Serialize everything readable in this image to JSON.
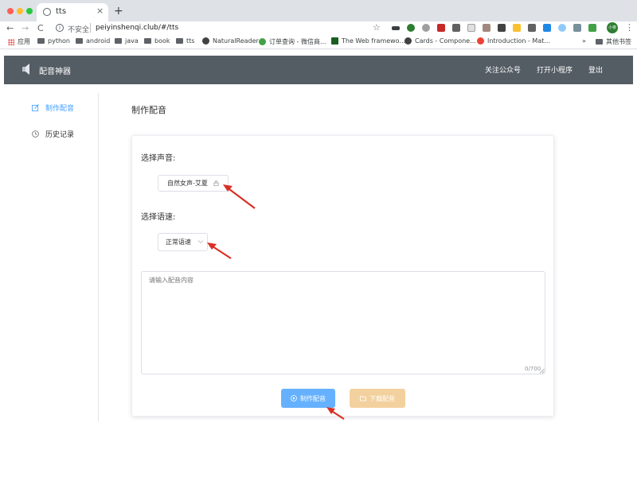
{
  "browser": {
    "tab_title": "tts",
    "tab_close": "×",
    "new_tab": "+",
    "nav_back": "←",
    "nav_forward": "→",
    "reload": "C",
    "security_label": "不安全",
    "url": "peiyinshenqi.club/#/tts",
    "star": "☆",
    "menu": "⋮",
    "avatar_text": "小夜",
    "bookmarks": [
      {
        "label": "应用",
        "icon": "apps-icon"
      },
      {
        "label": "python",
        "icon": "folder-icon"
      },
      {
        "label": "android",
        "icon": "folder-icon"
      },
      {
        "label": "java",
        "icon": "folder-icon"
      },
      {
        "label": "book",
        "icon": "folder-icon"
      },
      {
        "label": "tts",
        "icon": "folder-icon"
      },
      {
        "label": "NaturalReader",
        "icon": "globe-icon"
      },
      {
        "label": "订单查询 - 微信商...",
        "icon": "wechat-icon"
      },
      {
        "label": "The Web framewo...",
        "icon": "django-icon"
      },
      {
        "label": "Cards - Compone...",
        "icon": "globe-icon"
      },
      {
        "label": "Introduction - Mat...",
        "icon": "google-icon"
      },
      {
        "label": "»",
        "icon": "none"
      },
      {
        "label": "其他书签",
        "icon": "folder-icon"
      }
    ]
  },
  "header": {
    "title": "配音神器",
    "links": [
      "关注公众号",
      "打开小程序",
      "登出"
    ]
  },
  "sidebar": {
    "items": [
      {
        "label": "制作配音",
        "active": true
      },
      {
        "label": "历史记录",
        "active": false
      }
    ]
  },
  "main": {
    "page_title": "制作配音",
    "voice_label": "选择声音:",
    "voice_value": "自然女声-艾夏",
    "speed_label": "选择语速:",
    "speed_value": "正常语速",
    "textarea_placeholder": "请输入配音内容",
    "counter": "0/700",
    "make_button": "制作配音",
    "download_button": "下载配音"
  },
  "colors": {
    "header_bg": "#545c64",
    "active_nav": "#409eff",
    "primary_button": "#66b1ff",
    "disabled_button": "#f3d19e",
    "annotation_arrow": "#d93025"
  }
}
